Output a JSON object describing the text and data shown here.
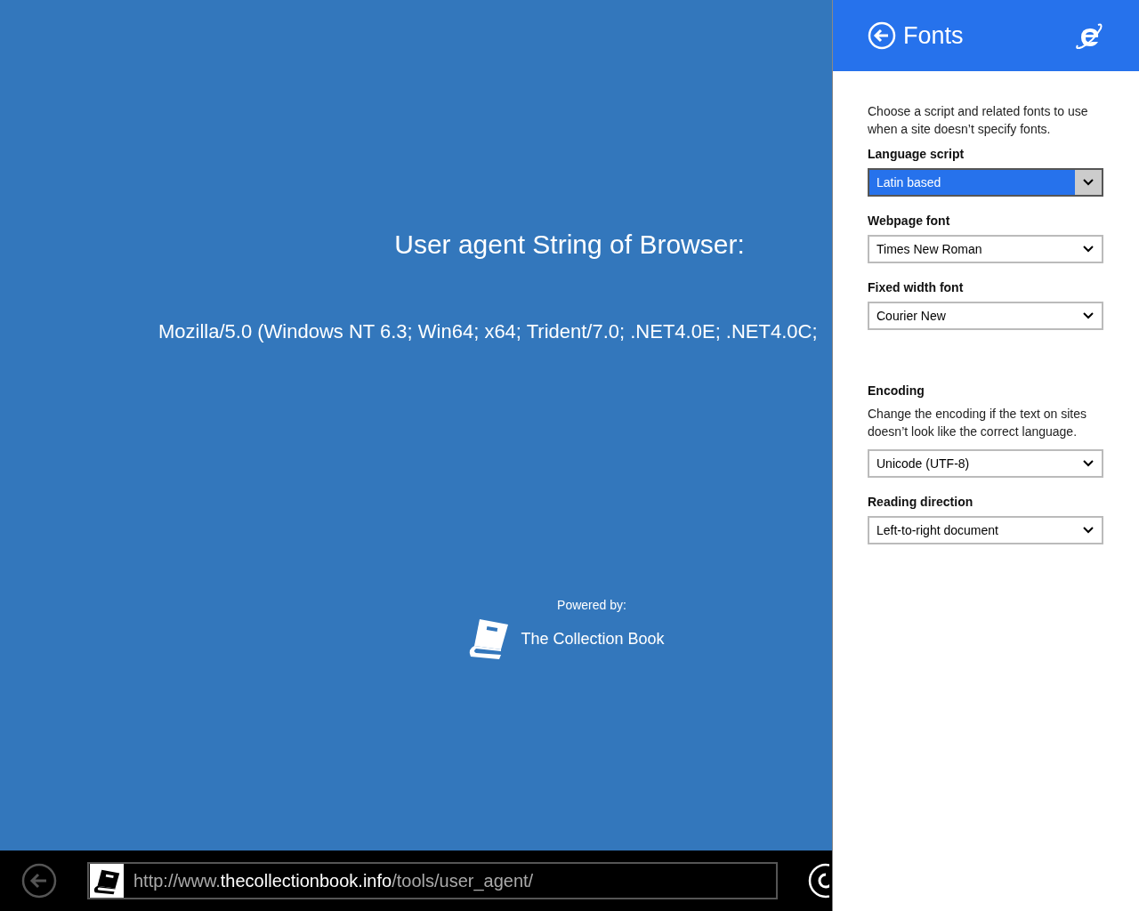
{
  "page": {
    "title": "User agent String of Browser:",
    "user_agent": "Mozilla/5.0 (Windows NT 6.3; Win64; x64; Trident/7.0; .NET4.0E; .NET4.0C;",
    "powered_by": "Powered by:",
    "brand": "The Collection Book"
  },
  "address_bar": {
    "url_prefix": "http://www.",
    "url_domain": "thecollectionbook.info",
    "url_path": "/tools/user_agent/"
  },
  "panel": {
    "title": "Fonts",
    "groups": [
      {
        "description": "Choose a script and related fonts to use when a site doesn’t specify fonts.",
        "items": [
          {
            "label": "Language script",
            "value": "Latin based",
            "focused": true
          },
          {
            "label": "Webpage font",
            "value": "Times New Roman",
            "focused": false
          },
          {
            "label": "Fixed width font",
            "value": "Courier New",
            "focused": false
          }
        ]
      },
      {
        "heading": "Encoding",
        "description": "Change the encoding if the text on sites doesn’t look like the correct language.",
        "items": [
          {
            "value": "Unicode (UTF-8)",
            "focused": false
          },
          {
            "label": "Reading direction",
            "value": "Left-to-right document",
            "focused": false
          }
        ]
      }
    ]
  }
}
